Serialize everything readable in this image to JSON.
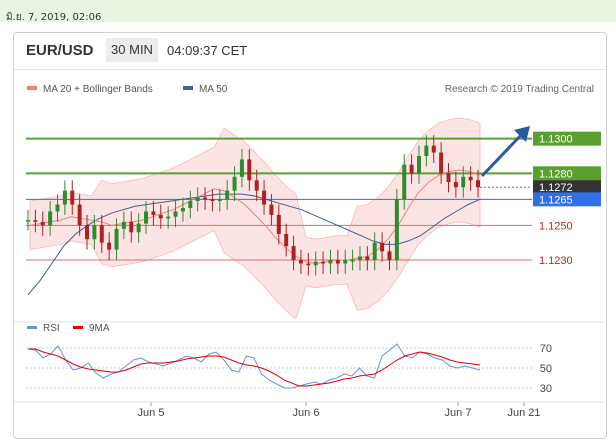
{
  "topbar": {
    "date_text": "มิ.ย. 7, 2019, 02:06"
  },
  "header": {
    "pair": "EUR/USD",
    "timeframe": "30 MIN",
    "time": "04:09:37 CET"
  },
  "legend": {
    "ma20_label": "MA 20 + Bollinger Bands",
    "ma50_label": "MA 50",
    "credit": "Research © 2019 Trading Central",
    "ma20_color": "#f08080",
    "ma50_color": "#3b5f8f"
  },
  "rsi_legend": {
    "rsi_label": "RSI",
    "ma_label": "9MA",
    "rsi_color": "#6b8fe0",
    "ma_color": "#e00000"
  },
  "colors": {
    "up": "#2e8b2e",
    "down": "#aa2222",
    "resistance": "#5aa02c",
    "pivot": "#2f6fe8",
    "support": "#d07070",
    "band": "#fde4e4"
  },
  "chart_data": [
    {
      "type": "candlestick",
      "title": "EUR/USD",
      "timeframe": "30 MIN",
      "x_ticks": [
        "Jun 5",
        "Jun 6",
        "Jun 7",
        "Jun 21"
      ],
      "ylim": [
        1.12,
        1.132
      ],
      "levels": [
        {
          "value": 1.13,
          "label": "1.1300",
          "kind": "resistance"
        },
        {
          "value": 1.128,
          "label": "1.1280",
          "kind": "resistance"
        },
        {
          "value": 1.1272,
          "label": "1.1272",
          "kind": "current"
        },
        {
          "value": 1.1265,
          "label": "1.1265",
          "kind": "pivot"
        },
        {
          "value": 1.125,
          "label": "1.1250",
          "kind": "support"
        },
        {
          "value": 1.123,
          "label": "1.1230",
          "kind": "support"
        }
      ],
      "close_path": [
        1.1253,
        1.1252,
        1.125,
        1.1258,
        1.1262,
        1.127,
        1.1262,
        1.125,
        1.1242,
        1.125,
        1.124,
        1.1236,
        1.1248,
        1.1252,
        1.1246,
        1.1251,
        1.1258,
        1.1256,
        1.1254,
        1.1255,
        1.1258,
        1.126,
        1.1264,
        1.1266,
        1.1265,
        1.1264,
        1.1265,
        1.127,
        1.1278,
        1.1288,
        1.1276,
        1.127,
        1.1262,
        1.1256,
        1.1245,
        1.1238,
        1.123,
        1.1228,
        1.1227,
        1.1229,
        1.1228,
        1.123,
        1.1228,
        1.123,
        1.123,
        1.1232,
        1.123,
        1.124,
        1.1235,
        1.123,
        1.1265,
        1.1285,
        1.128,
        1.129,
        1.1296,
        1.1292,
        1.128,
        1.1275,
        1.1272,
        1.1278,
        1.1276,
        1.1272
      ],
      "ma20": [
        1.125,
        1.1251,
        1.1252,
        1.1253,
        1.1255,
        1.1254,
        1.1253,
        1.1252,
        1.125,
        1.1251,
        1.1252,
        1.1253,
        1.1255,
        1.1257,
        1.1259,
        1.1262,
        1.1265,
        1.1268,
        1.1271,
        1.127,
        1.1266,
        1.1262,
        1.1256,
        1.125,
        1.1243,
        1.1237,
        1.1232,
        1.1229,
        1.1228,
        1.1229,
        1.123,
        1.123,
        1.1231,
        1.1232,
        1.1236,
        1.1242,
        1.125,
        1.126,
        1.1269,
        1.1275,
        1.1279,
        1.1281,
        1.1282,
        1.1281,
        1.1279
      ],
      "ma50": [
        1.121,
        1.1218,
        1.1228,
        1.1238,
        1.1245,
        1.125,
        1.1254,
        1.1257,
        1.1259,
        1.1261,
        1.1262,
        1.1263,
        1.1264,
        1.1265,
        1.1266,
        1.1267,
        1.1268,
        1.1268,
        1.1268,
        1.1267,
        1.1265,
        1.1263,
        1.1261,
        1.1259,
        1.1256,
        1.1253,
        1.125,
        1.1247,
        1.1244,
        1.1241,
        1.1239,
        1.1239,
        1.1241,
        1.1244,
        1.1249,
        1.1254,
        1.1258,
        1.1262,
        1.1265
      ]
    },
    {
      "type": "line",
      "title": "RSI",
      "y_ticks": [
        70,
        50,
        30
      ],
      "ylim": [
        20,
        80
      ],
      "series": [
        {
          "name": "RSI",
          "values": [
            69,
            68,
            60,
            64,
            72,
            58,
            48,
            50,
            55,
            45,
            40,
            44,
            46,
            52,
            58,
            60,
            56,
            54,
            52,
            55,
            58,
            62,
            60,
            56,
            64,
            66,
            58,
            48,
            46,
            62,
            60,
            44,
            38,
            34,
            30,
            30,
            32,
            34,
            36,
            34,
            38,
            40,
            44,
            42,
            50,
            42,
            40,
            62,
            68,
            74,
            62,
            60,
            66,
            64,
            60,
            58,
            52,
            50,
            52,
            50,
            48
          ]
        },
        {
          "name": "9MA",
          "values": [
            69,
            69,
            66,
            64,
            62,
            58,
            54,
            51,
            49,
            48,
            47,
            46,
            46,
            48,
            51,
            54,
            55,
            55,
            55,
            56,
            57,
            59,
            60,
            61,
            62,
            62,
            61,
            58,
            55,
            53,
            52,
            50,
            47,
            43,
            38,
            35,
            32,
            32,
            33,
            34,
            35,
            37,
            39,
            40,
            42,
            43,
            44,
            48,
            53,
            58,
            62,
            64,
            66,
            65,
            63,
            61,
            58,
            56,
            55,
            54,
            53
          ]
        }
      ]
    }
  ]
}
